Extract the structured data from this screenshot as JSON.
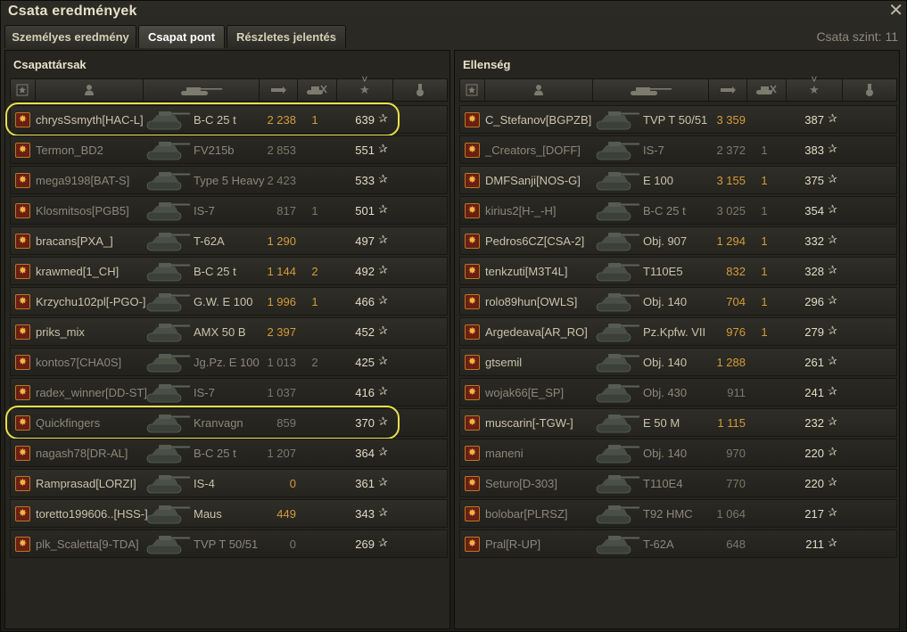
{
  "window": {
    "title": "Csata eredmények",
    "close_icon": "close-icon"
  },
  "tabs": [
    {
      "label": "Személyes eredmény",
      "active": false
    },
    {
      "label": "Csapat pont",
      "active": true
    },
    {
      "label": "Részletes jelentés",
      "active": false
    }
  ],
  "battle_level": "Csata szint: 11",
  "columns": [
    "squad-icon",
    "player-icon",
    "tank-icon",
    "damage-icon",
    "kills-icon",
    "xp-star-icon",
    "medal-icon"
  ],
  "colors": {
    "damage": "#d49b3a",
    "highlight": "#e9e04a",
    "medal_bg": "#6b1f12"
  },
  "allies": {
    "title": "Csapattársak",
    "rows": [
      {
        "name": "chrysSsmyth[HAC-L]",
        "tank": "B-C 25 t",
        "damage": "2 238",
        "kills": "1",
        "xp": "639",
        "alive": true,
        "highlighted": true
      },
      {
        "name": "Termon_BD2",
        "tank": "FV215b",
        "damage": "2 853",
        "kills": "",
        "xp": "551",
        "alive": false
      },
      {
        "name": "mega9198[BAT-S]",
        "tank": "Type 5 Heavy",
        "damage": "2 423",
        "kills": "",
        "xp": "533",
        "alive": false
      },
      {
        "name": "Klosmitsos[PGB5]",
        "tank": "IS-7",
        "damage": "817",
        "kills": "1",
        "xp": "501",
        "alive": false
      },
      {
        "name": "bracans[PXA_]",
        "tank": "T-62A",
        "damage": "1 290",
        "kills": "",
        "xp": "497",
        "alive": true
      },
      {
        "name": "krawmed[1_CH]",
        "tank": "B-C 25 t",
        "damage": "1 144",
        "kills": "2",
        "xp": "492",
        "alive": true
      },
      {
        "name": "Krzychu102pl[-PGO-]",
        "tank": "G.W. E 100",
        "damage": "1 996",
        "kills": "1",
        "xp": "466",
        "alive": true
      },
      {
        "name": "priks_mix",
        "tank": "AMX 50 B",
        "damage": "2 397",
        "kills": "",
        "xp": "452",
        "alive": true
      },
      {
        "name": "kontos7[CHA0S]",
        "tank": "Jg.Pz. E 100",
        "damage": "1 013",
        "kills": "2",
        "xp": "425",
        "alive": false
      },
      {
        "name": "radex_winner[DD-ST]",
        "tank": "IS-7",
        "damage": "1 037",
        "kills": "",
        "xp": "416",
        "alive": false
      },
      {
        "name": "Quickfingers",
        "tank": "Kranvagn",
        "damage": "859",
        "kills": "",
        "xp": "370",
        "alive": false,
        "highlighted": true
      },
      {
        "name": "nagash78[DR-AL]",
        "tank": "B-C 25 t",
        "damage": "1 207",
        "kills": "",
        "xp": "364",
        "alive": false
      },
      {
        "name": "Ramprasad[LORZI]",
        "tank": "IS-4",
        "damage": "0",
        "kills": "",
        "xp": "361",
        "alive": true
      },
      {
        "name": "toretto199606..[HSS-]",
        "tank": "Maus",
        "damage": "449",
        "kills": "",
        "xp": "343",
        "alive": true
      },
      {
        "name": "plk_Scaletta[9-TDA]",
        "tank": "TVP T 50/51",
        "damage": "0",
        "kills": "",
        "xp": "269",
        "alive": false
      }
    ]
  },
  "enemies": {
    "title": "Ellenség",
    "rows": [
      {
        "name": "C_Stefanov[BGPZB]",
        "tank": "TVP T 50/51",
        "damage": "3 359",
        "kills": "",
        "xp": "387",
        "alive": true
      },
      {
        "name": "_Creators_[DOFF]",
        "tank": "IS-7",
        "damage": "2 372",
        "kills": "1",
        "xp": "383",
        "alive": false
      },
      {
        "name": "DMFSanji[NOS-G]",
        "tank": "E 100",
        "damage": "3 155",
        "kills": "1",
        "xp": "375",
        "alive": true
      },
      {
        "name": "kirius2[H-_-H]",
        "tank": "B-C 25 t",
        "damage": "3 025",
        "kills": "1",
        "xp": "354",
        "alive": false
      },
      {
        "name": "Pedros6CZ[CSA-2]",
        "tank": "Obj. 907",
        "damage": "1 294",
        "kills": "1",
        "xp": "332",
        "alive": true
      },
      {
        "name": "tenkzuti[M3T4L]",
        "tank": "T110E5",
        "damage": "832",
        "kills": "1",
        "xp": "328",
        "alive": true
      },
      {
        "name": "rolo89hun[OWLS]",
        "tank": "Obj. 140",
        "damage": "704",
        "kills": "1",
        "xp": "296",
        "alive": true
      },
      {
        "name": "Argedeava[AR_RO]",
        "tank": "Pz.Kpfw. VII",
        "damage": "976",
        "kills": "1",
        "xp": "279",
        "alive": true
      },
      {
        "name": "gtsemil",
        "tank": "Obj. 140",
        "damage": "1 288",
        "kills": "",
        "xp": "261",
        "alive": true
      },
      {
        "name": "wojak66[E_SP]",
        "tank": "Obj. 430",
        "damage": "911",
        "kills": "",
        "xp": "241",
        "alive": false
      },
      {
        "name": "muscarin[-TGW-]",
        "tank": "E 50 M",
        "damage": "1 115",
        "kills": "",
        "xp": "232",
        "alive": true
      },
      {
        "name": "maneni",
        "tank": "Obj. 140",
        "damage": "970",
        "kills": "",
        "xp": "220",
        "alive": false
      },
      {
        "name": "Seturo[D-303]",
        "tank": "T110E4",
        "damage": "770",
        "kills": "",
        "xp": "220",
        "alive": false
      },
      {
        "name": "bolobar[PLRSZ]",
        "tank": "T92 HMC",
        "damage": "1 064",
        "kills": "",
        "xp": "217",
        "alive": false
      },
      {
        "name": "Pral[R-UP]",
        "tank": "T-62A",
        "damage": "648",
        "kills": "",
        "xp": "211",
        "alive": false
      }
    ]
  }
}
